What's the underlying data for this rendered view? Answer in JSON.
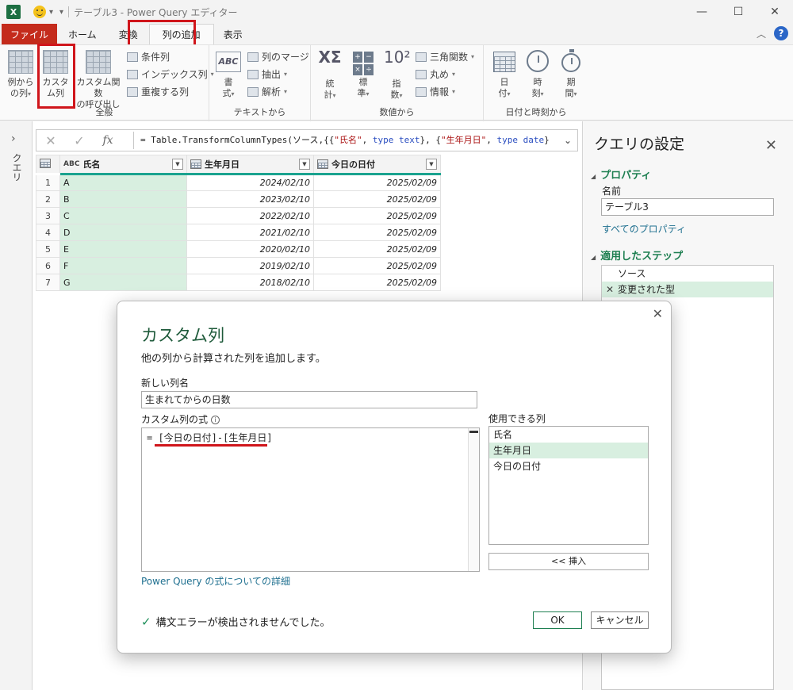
{
  "titlebar": {
    "logo": "X",
    "title": "テーブル3 - Power Query エディター",
    "minimize": "—",
    "maximize": "☐",
    "close": "✕"
  },
  "tabs": [
    {
      "label": "ファイル"
    },
    {
      "label": "ホーム"
    },
    {
      "label": "変換"
    },
    {
      "label": "列の追加"
    },
    {
      "label": "表示"
    }
  ],
  "ribbon": {
    "groups": {
      "general": "全般",
      "text": "テキストから",
      "number": "数値から",
      "datetime": "日付と時刻から"
    },
    "col_from_examples": [
      "例から",
      "の列"
    ],
    "custom_col": [
      "カスタ",
      "ム列"
    ],
    "invoke_func": [
      "カスタム関数",
      "の呼び出し"
    ],
    "conditional": "条件列",
    "index": "インデックス列",
    "duplicate": "重複する列",
    "format": [
      "書",
      "式"
    ],
    "merge": "列のマージ",
    "extract": "抽出",
    "parse": "解析",
    "stats": [
      "統",
      "計"
    ],
    "standard": [
      "標",
      "準"
    ],
    "scientific": [
      "指",
      "数"
    ],
    "trig": "三角関数",
    "rounding": "丸め",
    "info": "情報",
    "date": [
      "日",
      "付"
    ],
    "time": [
      "時",
      "刻"
    ],
    "duration": [
      "期",
      "間"
    ],
    "abc_glyph": "ABC",
    "ten_glyph": "10²",
    "sigma_glyph": "XΣ"
  },
  "query_pane": {
    "label": "クエリ"
  },
  "formula": {
    "prefix": "= Table.TransformColumnTypes(ソース,{{",
    "s1": "\"氏名\"",
    "kw1": "type text",
    "s2": "\"生年月日\"",
    "kw2": "type date",
    "suffix": "}"
  },
  "grid": {
    "columns": [
      {
        "name": "氏名",
        "type": "ABC"
      },
      {
        "name": "生年月日",
        "type": "date"
      },
      {
        "name": "今日の日付",
        "type": "date"
      }
    ],
    "rows": [
      {
        "n": "1",
        "name": "A",
        "birth": "2024/02/10",
        "today": "2025/02/09"
      },
      {
        "n": "2",
        "name": "B",
        "birth": "2023/02/10",
        "today": "2025/02/09"
      },
      {
        "n": "3",
        "name": "C",
        "birth": "2022/02/10",
        "today": "2025/02/09"
      },
      {
        "n": "4",
        "name": "D",
        "birth": "2021/02/10",
        "today": "2025/02/09"
      },
      {
        "n": "5",
        "name": "E",
        "birth": "2020/02/10",
        "today": "2025/02/09"
      },
      {
        "n": "6",
        "name": "F",
        "birth": "2019/02/10",
        "today": "2025/02/09"
      },
      {
        "n": "7",
        "name": "G",
        "birth": "2018/02/10",
        "today": "2025/02/09"
      }
    ]
  },
  "settings": {
    "title": "クエリの設定",
    "properties": "プロパティ",
    "name_label": "名前",
    "name_value": "テーブル3",
    "all_props": "すべてのプロパティ",
    "applied_steps": "適用したステップ",
    "steps": [
      "ソース",
      "変更された型"
    ]
  },
  "modal": {
    "title": "カスタム列",
    "description": "他の列から計算された列を追加します。",
    "new_col_label": "新しい列名",
    "new_col_value": "生まれてからの日数",
    "formula_label": "カスタム列の式",
    "formula_value": "= [今日の日付]-[生年月日]",
    "available_label": "使用できる列",
    "available_columns": [
      "氏名",
      "生年月日",
      "今日の日付"
    ],
    "insert": "<< 挿入",
    "learn_link": "Power Query の式についての詳細",
    "status": "構文エラーが検出されませんでした。",
    "ok": "OK",
    "cancel": "キャンセル"
  },
  "colors": {
    "accent_green": "#1e7f51",
    "highlight_red": "#d0151b",
    "file_tab": "#c42b1c",
    "selection": "#d8efe0"
  }
}
